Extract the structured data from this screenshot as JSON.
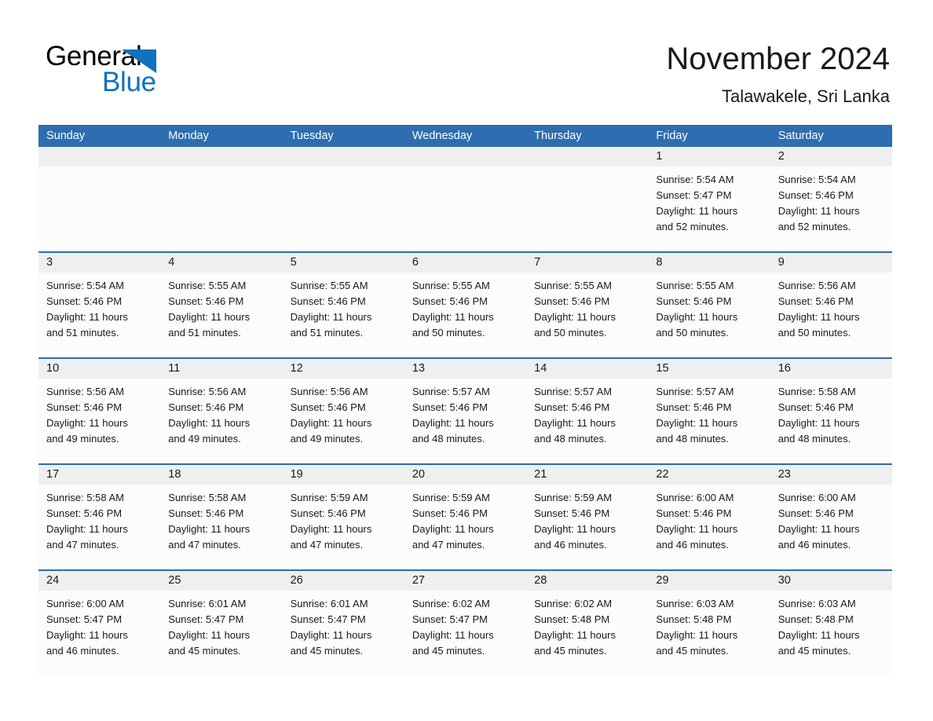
{
  "brand": {
    "logo_line1": "General",
    "logo_line2": "Blue",
    "logo_accent_color": "#1071BF",
    "triangle_icon": "blue-triangle-icon"
  },
  "header": {
    "month_title": "November 2024",
    "location": "Talawakele, Sri Lanka"
  },
  "theme": {
    "header_blue": "#2E6DAF",
    "daynum_band_gray": "#EFEFEF",
    "cell_background": "#FCFCFC",
    "text_color": "#1a1a1a"
  },
  "weekdays": [
    "Sunday",
    "Monday",
    "Tuesday",
    "Wednesday",
    "Thursday",
    "Friday",
    "Saturday"
  ],
  "weeks": [
    [
      {
        "day": "",
        "empty": true
      },
      {
        "day": "",
        "empty": true
      },
      {
        "day": "",
        "empty": true
      },
      {
        "day": "",
        "empty": true
      },
      {
        "day": "",
        "empty": true
      },
      {
        "day": "1",
        "sunrise": "Sunrise: 5:54 AM",
        "sunset": "Sunset: 5:47 PM",
        "daylight_line1": "Daylight: 11 hours",
        "daylight_line2": "and 52 minutes."
      },
      {
        "day": "2",
        "sunrise": "Sunrise: 5:54 AM",
        "sunset": "Sunset: 5:46 PM",
        "daylight_line1": "Daylight: 11 hours",
        "daylight_line2": "and 52 minutes."
      }
    ],
    [
      {
        "day": "3",
        "sunrise": "Sunrise: 5:54 AM",
        "sunset": "Sunset: 5:46 PM",
        "daylight_line1": "Daylight: 11 hours",
        "daylight_line2": "and 51 minutes."
      },
      {
        "day": "4",
        "sunrise": "Sunrise: 5:55 AM",
        "sunset": "Sunset: 5:46 PM",
        "daylight_line1": "Daylight: 11 hours",
        "daylight_line2": "and 51 minutes."
      },
      {
        "day": "5",
        "sunrise": "Sunrise: 5:55 AM",
        "sunset": "Sunset: 5:46 PM",
        "daylight_line1": "Daylight: 11 hours",
        "daylight_line2": "and 51 minutes."
      },
      {
        "day": "6",
        "sunrise": "Sunrise: 5:55 AM",
        "sunset": "Sunset: 5:46 PM",
        "daylight_line1": "Daylight: 11 hours",
        "daylight_line2": "and 50 minutes."
      },
      {
        "day": "7",
        "sunrise": "Sunrise: 5:55 AM",
        "sunset": "Sunset: 5:46 PM",
        "daylight_line1": "Daylight: 11 hours",
        "daylight_line2": "and 50 minutes."
      },
      {
        "day": "8",
        "sunrise": "Sunrise: 5:55 AM",
        "sunset": "Sunset: 5:46 PM",
        "daylight_line1": "Daylight: 11 hours",
        "daylight_line2": "and 50 minutes."
      },
      {
        "day": "9",
        "sunrise": "Sunrise: 5:56 AM",
        "sunset": "Sunset: 5:46 PM",
        "daylight_line1": "Daylight: 11 hours",
        "daylight_line2": "and 50 minutes."
      }
    ],
    [
      {
        "day": "10",
        "sunrise": "Sunrise: 5:56 AM",
        "sunset": "Sunset: 5:46 PM",
        "daylight_line1": "Daylight: 11 hours",
        "daylight_line2": "and 49 minutes."
      },
      {
        "day": "11",
        "sunrise": "Sunrise: 5:56 AM",
        "sunset": "Sunset: 5:46 PM",
        "daylight_line1": "Daylight: 11 hours",
        "daylight_line2": "and 49 minutes."
      },
      {
        "day": "12",
        "sunrise": "Sunrise: 5:56 AM",
        "sunset": "Sunset: 5:46 PM",
        "daylight_line1": "Daylight: 11 hours",
        "daylight_line2": "and 49 minutes."
      },
      {
        "day": "13",
        "sunrise": "Sunrise: 5:57 AM",
        "sunset": "Sunset: 5:46 PM",
        "daylight_line1": "Daylight: 11 hours",
        "daylight_line2": "and 48 minutes."
      },
      {
        "day": "14",
        "sunrise": "Sunrise: 5:57 AM",
        "sunset": "Sunset: 5:46 PM",
        "daylight_line1": "Daylight: 11 hours",
        "daylight_line2": "and 48 minutes."
      },
      {
        "day": "15",
        "sunrise": "Sunrise: 5:57 AM",
        "sunset": "Sunset: 5:46 PM",
        "daylight_line1": "Daylight: 11 hours",
        "daylight_line2": "and 48 minutes."
      },
      {
        "day": "16",
        "sunrise": "Sunrise: 5:58 AM",
        "sunset": "Sunset: 5:46 PM",
        "daylight_line1": "Daylight: 11 hours",
        "daylight_line2": "and 48 minutes."
      }
    ],
    [
      {
        "day": "17",
        "sunrise": "Sunrise: 5:58 AM",
        "sunset": "Sunset: 5:46 PM",
        "daylight_line1": "Daylight: 11 hours",
        "daylight_line2": "and 47 minutes."
      },
      {
        "day": "18",
        "sunrise": "Sunrise: 5:58 AM",
        "sunset": "Sunset: 5:46 PM",
        "daylight_line1": "Daylight: 11 hours",
        "daylight_line2": "and 47 minutes."
      },
      {
        "day": "19",
        "sunrise": "Sunrise: 5:59 AM",
        "sunset": "Sunset: 5:46 PM",
        "daylight_line1": "Daylight: 11 hours",
        "daylight_line2": "and 47 minutes."
      },
      {
        "day": "20",
        "sunrise": "Sunrise: 5:59 AM",
        "sunset": "Sunset: 5:46 PM",
        "daylight_line1": "Daylight: 11 hours",
        "daylight_line2": "and 47 minutes."
      },
      {
        "day": "21",
        "sunrise": "Sunrise: 5:59 AM",
        "sunset": "Sunset: 5:46 PM",
        "daylight_line1": "Daylight: 11 hours",
        "daylight_line2": "and 46 minutes."
      },
      {
        "day": "22",
        "sunrise": "Sunrise: 6:00 AM",
        "sunset": "Sunset: 5:46 PM",
        "daylight_line1": "Daylight: 11 hours",
        "daylight_line2": "and 46 minutes."
      },
      {
        "day": "23",
        "sunrise": "Sunrise: 6:00 AM",
        "sunset": "Sunset: 5:46 PM",
        "daylight_line1": "Daylight: 11 hours",
        "daylight_line2": "and 46 minutes."
      }
    ],
    [
      {
        "day": "24",
        "sunrise": "Sunrise: 6:00 AM",
        "sunset": "Sunset: 5:47 PM",
        "daylight_line1": "Daylight: 11 hours",
        "daylight_line2": "and 46 minutes."
      },
      {
        "day": "25",
        "sunrise": "Sunrise: 6:01 AM",
        "sunset": "Sunset: 5:47 PM",
        "daylight_line1": "Daylight: 11 hours",
        "daylight_line2": "and 45 minutes."
      },
      {
        "day": "26",
        "sunrise": "Sunrise: 6:01 AM",
        "sunset": "Sunset: 5:47 PM",
        "daylight_line1": "Daylight: 11 hours",
        "daylight_line2": "and 45 minutes."
      },
      {
        "day": "27",
        "sunrise": "Sunrise: 6:02 AM",
        "sunset": "Sunset: 5:47 PM",
        "daylight_line1": "Daylight: 11 hours",
        "daylight_line2": "and 45 minutes."
      },
      {
        "day": "28",
        "sunrise": "Sunrise: 6:02 AM",
        "sunset": "Sunset: 5:48 PM",
        "daylight_line1": "Daylight: 11 hours",
        "daylight_line2": "and 45 minutes."
      },
      {
        "day": "29",
        "sunrise": "Sunrise: 6:03 AM",
        "sunset": "Sunset: 5:48 PM",
        "daylight_line1": "Daylight: 11 hours",
        "daylight_line2": "and 45 minutes."
      },
      {
        "day": "30",
        "sunrise": "Sunrise: 6:03 AM",
        "sunset": "Sunset: 5:48 PM",
        "daylight_line1": "Daylight: 11 hours",
        "daylight_line2": "and 45 minutes."
      }
    ]
  ]
}
